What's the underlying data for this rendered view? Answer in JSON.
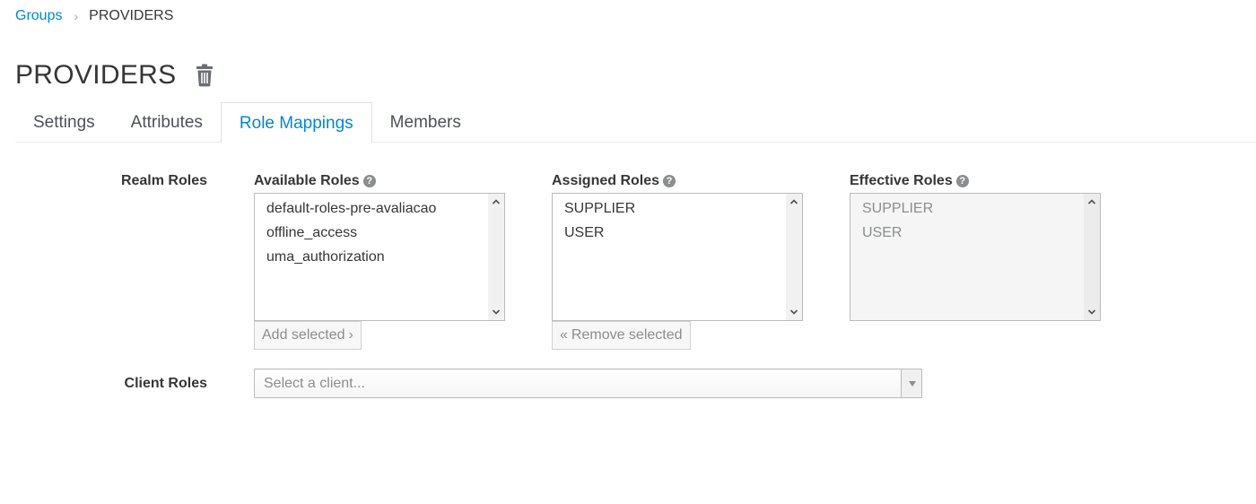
{
  "breadcrumb": {
    "parent": "Groups",
    "separator": "›",
    "current": "PROVIDERS"
  },
  "page": {
    "title": "PROVIDERS",
    "delete_icon": "trash-icon"
  },
  "tabs": [
    {
      "label": "Settings",
      "active": false
    },
    {
      "label": "Attributes",
      "active": false
    },
    {
      "label": "Role Mappings",
      "active": true
    },
    {
      "label": "Members",
      "active": false
    }
  ],
  "realm_roles": {
    "label": "Realm Roles",
    "help_glyph": "?",
    "available": {
      "header": "Available Roles",
      "items": [
        "default-roles-pre-avaliacao",
        "offline_access",
        "uma_authorization"
      ],
      "button_label": "Add selected",
      "button_glyph": "›"
    },
    "assigned": {
      "header": "Assigned Roles",
      "items": [
        "SUPPLIER",
        "USER"
      ],
      "button_label": "Remove selected",
      "button_glyph": "«"
    },
    "effective": {
      "header": "Effective Roles",
      "items": [
        "SUPPLIER",
        "USER"
      ]
    }
  },
  "client_roles": {
    "label": "Client Roles",
    "placeholder": "Select a client..."
  },
  "colors": {
    "link": "#0088ce",
    "text": "#363636",
    "muted": "#8b8d8f"
  }
}
